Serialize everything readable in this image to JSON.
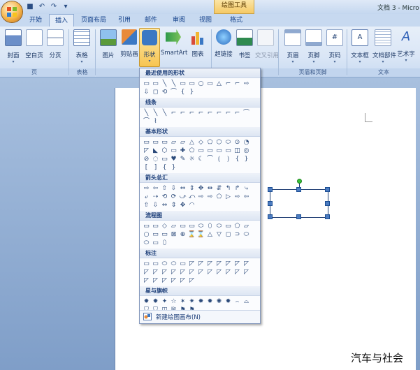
{
  "window": {
    "title": "文档 3 - Micro",
    "context_tab": "绘图工具",
    "quick_access": [
      "save-icon",
      "undo-icon",
      "redo-icon",
      "customize-icon"
    ],
    "quick_access_glyphs": [
      "■",
      "↶",
      "↷",
      "▾"
    ]
  },
  "tabs": [
    {
      "label": "开始",
      "active": false
    },
    {
      "label": "插入",
      "active": true
    },
    {
      "label": "页面布局",
      "active": false
    },
    {
      "label": "引用",
      "active": false
    },
    {
      "label": "邮件",
      "active": false
    },
    {
      "label": "审阅",
      "active": false
    },
    {
      "label": "视图",
      "active": false
    },
    {
      "label": "格式",
      "active": false
    }
  ],
  "ribbon": {
    "groups": [
      {
        "name": "页"
      },
      {
        "name": "表格"
      },
      {
        "name": "插图"
      },
      {
        "name": "链接"
      },
      {
        "name": "页眉和页脚"
      },
      {
        "name": "文本"
      }
    ],
    "buttons": [
      {
        "label": "封面",
        "icon": "cover-page-icon",
        "color": "#6c8fc9",
        "dropdown": true
      },
      {
        "label": "空白页",
        "icon": "blank-page-icon",
        "color": "#ffffff",
        "dropdown": false
      },
      {
        "label": "分页",
        "icon": "page-break-icon",
        "color": "#d7dde8",
        "dropdown": false
      },
      {
        "label": "表格",
        "icon": "table-icon",
        "color": "#f0f4fb",
        "dropdown": true
      },
      {
        "label": "图片",
        "icon": "picture-icon",
        "color": "#7fa7d4",
        "dropdown": false
      },
      {
        "label": "剪贴画",
        "icon": "clipart-icon",
        "color": "#e88a3a",
        "dropdown": false
      },
      {
        "label": "形状",
        "icon": "shapes-icon",
        "color": "#3b78c4",
        "dropdown": true
      },
      {
        "label": "SmartArt",
        "icon": "smartart-icon",
        "color": "#2f9a4a",
        "dropdown": false
      },
      {
        "label": "图表",
        "icon": "chart-icon",
        "color": "#d84b3a",
        "dropdown": false
      },
      {
        "label": "超链接",
        "icon": "hyperlink-icon",
        "color": "#2b6cc0",
        "dropdown": false
      },
      {
        "label": "书签",
        "icon": "bookmark-icon",
        "color": "#2f8a4f",
        "dropdown": false
      },
      {
        "label": "交叉引用",
        "icon": "cross-reference-icon",
        "color": "#b8c4d6",
        "dropdown": false
      },
      {
        "label": "页眉",
        "icon": "header-icon",
        "color": "#ffffff",
        "dropdown": true
      },
      {
        "label": "页脚",
        "icon": "footer-icon",
        "color": "#ffffff",
        "dropdown": true
      },
      {
        "label": "页码",
        "icon": "page-number-icon",
        "color": "#ffffff",
        "dropdown": true
      },
      {
        "label": "文本框",
        "icon": "textbox-icon",
        "color": "#ffffff",
        "dropdown": true
      },
      {
        "label": "文档部件",
        "icon": "quick-parts-icon",
        "color": "#ffffff",
        "dropdown": true
      },
      {
        "label": "艺术字",
        "icon": "wordart-icon",
        "color": "#2d5fb6",
        "dropdown": true
      }
    ]
  },
  "shapes_gallery": {
    "categories": [
      {
        "name": "最近使用的形状",
        "glyphs": [
          "▭",
          "▭",
          "╲",
          "╲",
          "▭",
          "▭",
          "○",
          "▭",
          "△",
          "⌐",
          "⌐",
          "⇨",
          "⇩",
          "◻",
          "⟲",
          "⌒",
          "{",
          "}"
        ]
      },
      {
        "name": "线条",
        "glyphs": [
          "╲",
          "╲",
          "╲",
          "⌐",
          "⌐",
          "⌐",
          "⌐",
          "⌐",
          "⌐",
          "⌐",
          "⌐",
          "⌒",
          "⌒",
          "⌇"
        ]
      },
      {
        "name": "基本形状",
        "glyphs": [
          "▭",
          "▭",
          "▭",
          "▱",
          "▱",
          "△",
          "◇",
          "⬠",
          "⬡",
          "⬭",
          "⊙",
          "◔",
          "◸",
          "◣",
          "⬡",
          "▭",
          "✚",
          "⬠",
          "▭",
          "▭",
          "▭",
          "▭",
          "◫",
          "◎",
          "⊘",
          "◌",
          "▭",
          "♥",
          "✎",
          "☼",
          "☾",
          "⌒",
          "⟮",
          "⟯",
          "{",
          "}",
          "[",
          "]",
          "{",
          "}"
        ]
      },
      {
        "name": "箭头总汇",
        "glyphs": [
          "⇨",
          "⇦",
          "⇧",
          "⇩",
          "⇔",
          "⇕",
          "✥",
          "⇹",
          "⇵",
          "↰",
          "↱",
          "⤷",
          "⤶",
          "⇢",
          "⟲",
          "⟳",
          "⤻",
          "⤺",
          "⇨",
          "⇨",
          "⬠",
          "▷",
          "⇨",
          "⇦",
          "⇧",
          "⇩",
          "⇔",
          "⇕",
          "✥",
          "◠"
        ]
      },
      {
        "name": "流程图",
        "glyphs": [
          "▭",
          "▭",
          "◇",
          "▱",
          "▭",
          "▭",
          "⬭",
          "⬯",
          "⬭",
          "▭",
          "⬠",
          "▱",
          "○",
          "▭",
          "▭",
          "⊠",
          "⊕",
          "⌛",
          "⌛",
          "△",
          "▽",
          "◻",
          "⊃",
          "⬭",
          "⬭",
          "▭",
          "⬯"
        ]
      },
      {
        "name": "标注",
        "glyphs": [
          "▭",
          "▭",
          "⬭",
          "⬭",
          "▭",
          "◸",
          "◸",
          "◸",
          "◸",
          "◸",
          "◸",
          "◸",
          "◸",
          "◸",
          "◸",
          "◸",
          "◸",
          "◸",
          "◸",
          "◸",
          "◸",
          "◸",
          "◸",
          "◸",
          "◸",
          "◸",
          "◸",
          "◸",
          "◸",
          "◸"
        ]
      },
      {
        "name": "星与旗帜",
        "glyphs": [
          "✹",
          "✹",
          "✦",
          "☆",
          "✶",
          "✷",
          "✸",
          "✹",
          "✺",
          "✹",
          "⌢",
          "⌓",
          "⛉",
          "⛉",
          "◫",
          "⛿",
          "⚑",
          "⚑"
        ]
      }
    ],
    "new_canvas_label": "新建绘图画布(N)"
  },
  "watermark": "汽车与社会"
}
